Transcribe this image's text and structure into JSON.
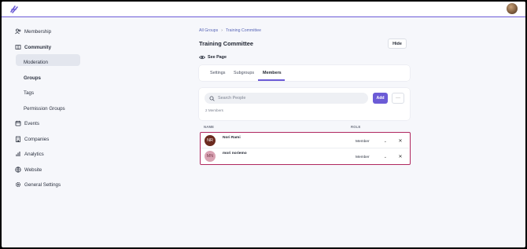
{
  "app": {
    "logo_icon": "bolt-logo-icon",
    "accent_color": "#6b5bd6",
    "highlight_color": "#b0275f"
  },
  "sidebar": {
    "items": [
      {
        "label": "Membership",
        "icon": "users-icon"
      },
      {
        "label": "Community",
        "icon": "book-icon"
      },
      {
        "label": "Moderation"
      },
      {
        "label": "Groups"
      },
      {
        "label": "Tags"
      },
      {
        "label": "Permission Groups"
      },
      {
        "label": "Events",
        "icon": "calendar-icon"
      },
      {
        "label": "Companies",
        "icon": "building-icon"
      },
      {
        "label": "Analytics",
        "icon": "bar-chart-icon"
      },
      {
        "label": "Website",
        "icon": "globe-icon"
      },
      {
        "label": "General Settings",
        "icon": "gear-icon"
      }
    ],
    "active_item": "Groups"
  },
  "breadcrumb": {
    "root": "All Groups",
    "separator": "›",
    "current": "Training Committee"
  },
  "page": {
    "title": "Training Committee",
    "hide_label": "Hide",
    "see_page_label": "See Page"
  },
  "tabs": [
    {
      "label": "Settings"
    },
    {
      "label": "Subgroups"
    },
    {
      "label": "Members",
      "active": true
    }
  ],
  "members": {
    "search_placeholder": "Search People",
    "add_label": "Add",
    "more_label": "···",
    "count_label": "2 Members",
    "columns": {
      "name": "NAME",
      "role": "ROLE"
    },
    "rows": [
      {
        "initials": "NR",
        "name": "Nori Rami",
        "role": "Member",
        "avatar_bg": "#6b2a1f",
        "avatar_fg": "#ffffff"
      },
      {
        "initials": "MN",
        "name": "mori noriemo",
        "role": "Member",
        "avatar_bg": "#d9a3b3",
        "avatar_fg": "#7a3a4c"
      }
    ],
    "remove_label": "✕",
    "role_chevron": "⌄"
  }
}
